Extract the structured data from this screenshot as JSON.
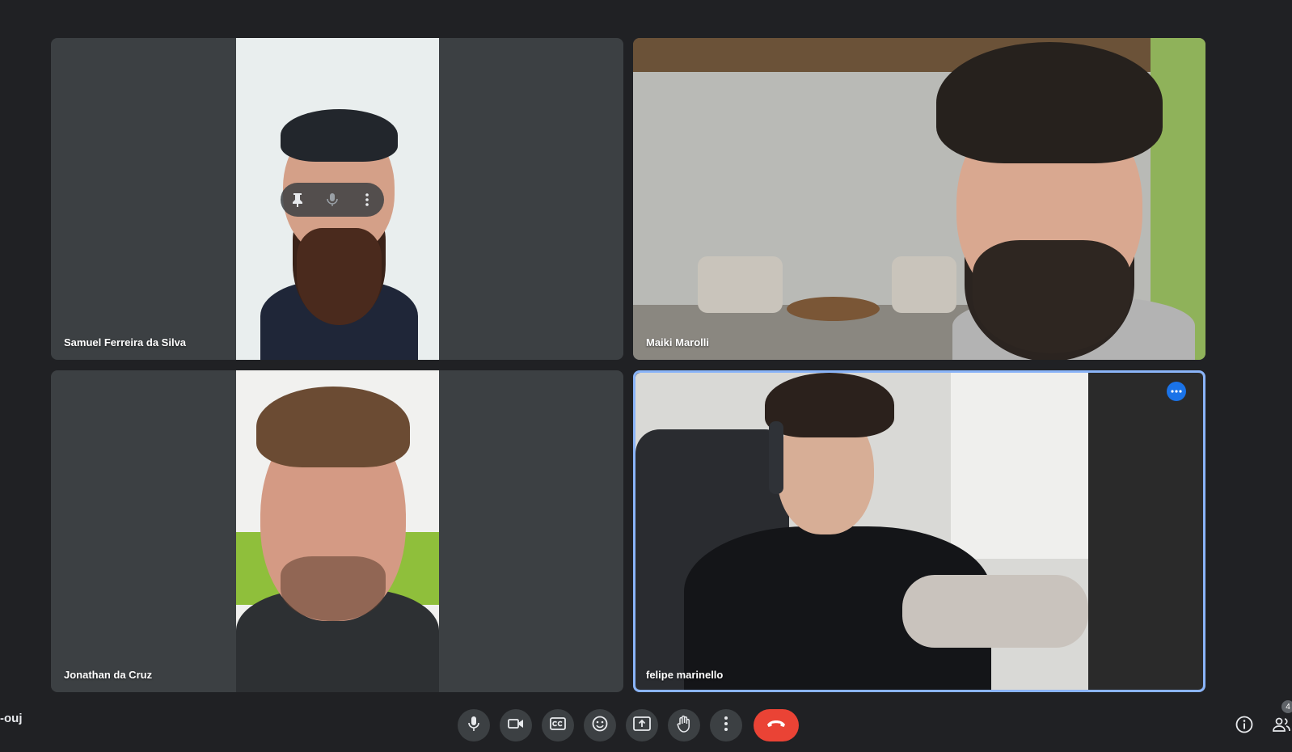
{
  "meeting": {
    "code": "-ouj"
  },
  "participants": [
    {
      "name": "Samuel Ferreira da Silva"
    },
    {
      "name": "Maiki Marolli"
    },
    {
      "name": "Jonathan da Cruz"
    },
    {
      "name": "felipe marinello"
    }
  ],
  "participant_count": "4",
  "colors": {
    "background": "#202124",
    "tile": "#3c4043",
    "active_border": "#8ab4f8",
    "end_call": "#ea4335",
    "accent": "#1a73e8"
  },
  "icons": {
    "tile_overlay": [
      "pin-icon",
      "microphone-icon",
      "more-vert-icon"
    ],
    "controls": [
      "microphone-icon",
      "camera-icon",
      "captions-icon",
      "emoji-icon",
      "present-icon",
      "raise-hand-icon",
      "more-vert-icon",
      "end-call-icon"
    ],
    "right": [
      "info-icon",
      "people-icon"
    ]
  }
}
